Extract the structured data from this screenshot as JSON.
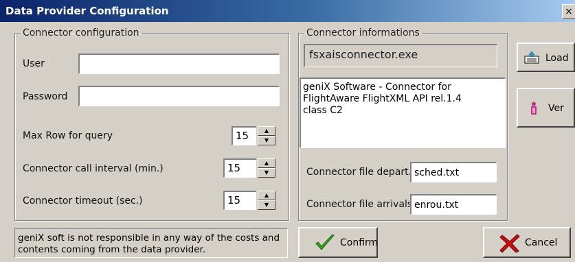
{
  "window": {
    "title": "Data Provider Configuration",
    "close_label": "×"
  },
  "connector_config": {
    "legend": "Connector configuration",
    "user_label": "User",
    "user_value": "",
    "password_label": "Password",
    "password_value": "",
    "max_row_label": "Max Row for query",
    "max_row_value": "15",
    "call_interval_label": "Connector call interval (min.)",
    "call_interval_value": "15",
    "timeout_label": "Connector timeout (sec.)",
    "timeout_value": "15"
  },
  "connector_info": {
    "legend": "Connector informations",
    "exe_name": "fsxaisconnector.exe",
    "description": "geniX Software - Connector for\nFlightAware FlightXML API rel.1.4\nclass C2",
    "file_depart_label": "Connector file depart.",
    "file_depart_value": "sched.txt",
    "file_arrivals_label": "Connector file arrivals",
    "file_arrivals_value": "enrou.txt"
  },
  "buttons": {
    "load": "Load",
    "ver": "Ver",
    "confirm": "Confirm",
    "cancel": "Cancel"
  },
  "notice": "geniX soft is not responsible in any way of the costs and contents coming from the data provider.",
  "colors": {
    "title_bar": "#0a246a",
    "window_bg": "#d4d0c8",
    "confirm_check": "#3aa020",
    "cancel_x": "#c81010"
  }
}
